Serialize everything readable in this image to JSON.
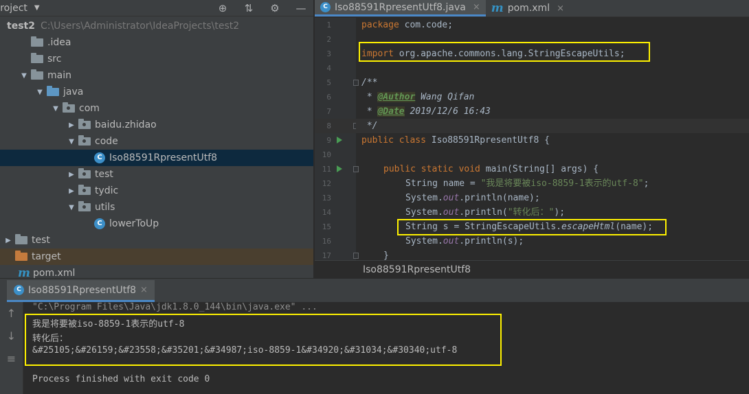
{
  "project": {
    "title": "Project",
    "tree": [
      {
        "label": "test2",
        "path": "C:\\Users\\Administrator\\IdeaProjects\\test2",
        "indent": 0,
        "type": "root",
        "expanded": true
      },
      {
        "label": ".idea",
        "indent": 1,
        "type": "folder",
        "arrow": ""
      },
      {
        "label": "src",
        "indent": 1,
        "type": "folder",
        "arrow": ""
      },
      {
        "label": "main",
        "indent": 1,
        "type": "folder",
        "arrow": "down"
      },
      {
        "label": "java",
        "indent": 2,
        "type": "folder-blue",
        "arrow": "down"
      },
      {
        "label": "com",
        "indent": 3,
        "type": "pkg",
        "arrow": "down"
      },
      {
        "label": "baidu.zhidao",
        "indent": 4,
        "type": "pkg",
        "arrow": "right"
      },
      {
        "label": "code",
        "indent": 4,
        "type": "pkg",
        "arrow": "down"
      },
      {
        "label": "Iso88591RpresentUtf8",
        "indent": 5,
        "type": "class",
        "selected": true
      },
      {
        "label": "test",
        "indent": 4,
        "type": "pkg",
        "arrow": "right"
      },
      {
        "label": "tydic",
        "indent": 4,
        "type": "pkg",
        "arrow": "right"
      },
      {
        "label": "utils",
        "indent": 4,
        "type": "pkg",
        "arrow": "down"
      },
      {
        "label": "lowerToUp",
        "indent": 5,
        "type": "class"
      },
      {
        "label": "test",
        "indent": 0,
        "type": "folder",
        "arrow": "right"
      },
      {
        "label": "target",
        "indent": 0,
        "type": "folder-orange",
        "arrow": "",
        "highlight": true
      },
      {
        "label": "pom.xml",
        "indent": 0,
        "type": "maven"
      }
    ]
  },
  "editor": {
    "tabs": [
      {
        "label": "Iso88591RpresentUtf8.java",
        "active": true,
        "icon": "class-icon"
      },
      {
        "label": "pom.xml",
        "active": false,
        "icon": "maven-icon"
      }
    ],
    "line_numbers": [
      "1",
      "2",
      "3",
      "4",
      "5",
      "6",
      "7",
      "8",
      "9",
      "10",
      "11",
      "12",
      "13",
      "14",
      "15",
      "16",
      "17"
    ],
    "code": {
      "l1_kw": "package",
      "l1_rest": " com.code;",
      "l3_kw": "import",
      "l3_rest": " org.apache.commons.lang.StringEscapeUtils;",
      "l5": "/**",
      "l6_pre": " * ",
      "l6_tag": "@Author",
      "l6_val": " Wang Qifan",
      "l7_pre": " * ",
      "l7_tag": "@Date",
      "l7_val": " 2019/12/6 16:43",
      "l8": " */",
      "l9_kw": "public class",
      "l9_rest": " Iso88591RpresentUtf8 {",
      "l11_kw": "public static void",
      "l11_rest": " main(String[] args) {",
      "l12_a": "String name = ",
      "l12_str": "\"我是将要被iso-8859-1表示的utf-8\"",
      "l12_b": ";",
      "l13_a": "System.",
      "l13_f": "out",
      "l13_b": ".println(name);",
      "l14_a": "System.",
      "l14_f": "out",
      "l14_b": ".println(",
      "l14_str": "\"转化后：\"",
      "l14_c": ");",
      "l15_a": "String s = StringEscapeUtils.",
      "l15_it": "escapeHtml",
      "l15_b": "(name);",
      "l16_a": "System.",
      "l16_f": "out",
      "l16_b": ".println(s);",
      "l17": "}"
    },
    "breadcrumb": "Iso88591RpresentUtf8"
  },
  "run": {
    "tab_label": "Iso88591RpresentUtf8",
    "command": "\"C:\\Program Files\\Java\\jdk1.8.0_144\\bin\\java.exe\" ...",
    "output": [
      "我是将要被iso-8859-1表示的utf-8",
      "转化后：",
      "&#25105;&#26159;&#23558;&#35201;&#34987;iso-8859-1&#34920;&#31034;&#30340;utf-8"
    ],
    "finish": "Process finished with exit code 0"
  },
  "colors": {
    "highlight_box": "#fff200",
    "keyword": "#cc7832",
    "string": "#6a8759"
  }
}
